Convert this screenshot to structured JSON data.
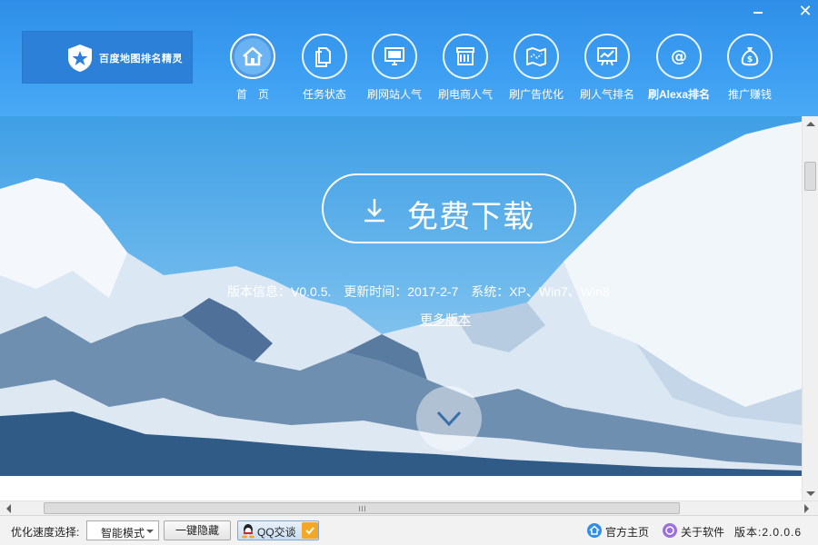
{
  "window": {
    "minimize_icon": "minimize-icon",
    "close_symbol": "✕"
  },
  "logo": {
    "text": "百度地图排名精灵",
    "icon": "shield-star-icon"
  },
  "nav": {
    "items": [
      {
        "label": "首　页",
        "icon": "home-icon"
      },
      {
        "label": "任务状态",
        "icon": "documents-icon"
      },
      {
        "label": "刷网站人气",
        "icon": "monitor-icon"
      },
      {
        "label": "刷电商人气",
        "icon": "store-icon"
      },
      {
        "label": "刷广告优化",
        "icon": "map-icon"
      },
      {
        "label": "刷人气排名",
        "icon": "chart-board-icon"
      },
      {
        "label": "刷Alexa排名",
        "icon": "at-icon"
      },
      {
        "label": "推广赚钱",
        "icon": "money-bag-icon"
      }
    ]
  },
  "hero": {
    "download_label": "免费下载",
    "version_label": "版本信息：V0.0.5.",
    "update_label": "更新时间：2017-2-7",
    "system_label": "系统：XP、Win7、Win8",
    "more_versions": "更多版本"
  },
  "statusbar": {
    "speed_label": "优化速度选择:",
    "speed_value": "智能模式",
    "hide_button": "一键隐藏",
    "qq_button": "QQ交谈",
    "home_link": "官方主页",
    "about_link": "关于软件",
    "version": "版本:2.0.0.6"
  },
  "colors": {
    "header_blue": "#3b9df1",
    "accent_white": "#ffffff"
  }
}
